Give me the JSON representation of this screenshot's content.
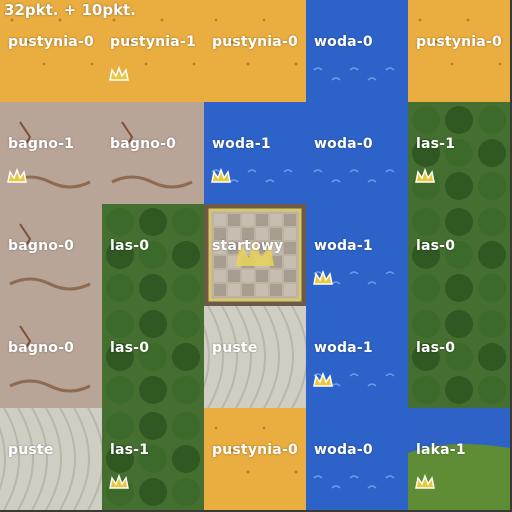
{
  "score": "32pkt. + 10pkt.",
  "tiles": [
    {
      "label": "pustynia-0",
      "terrain": "desert",
      "crowns": 0
    },
    {
      "label": "pustynia-1",
      "terrain": "desert",
      "crowns": 1
    },
    {
      "label": "pustynia-0",
      "terrain": "desert",
      "crowns": 0
    },
    {
      "label": "woda-0",
      "terrain": "water",
      "crowns": 0
    },
    {
      "label": "pustynia-0",
      "terrain": "desert",
      "crowns": 0
    },
    {
      "label": "bagno-1",
      "terrain": "swamp",
      "crowns": 1
    },
    {
      "label": "bagno-0",
      "terrain": "swamp",
      "crowns": 0
    },
    {
      "label": "woda-1",
      "terrain": "water",
      "crowns": 1
    },
    {
      "label": "woda-0",
      "terrain": "water",
      "crowns": 0
    },
    {
      "label": "las-1",
      "terrain": "forest",
      "crowns": 1
    },
    {
      "label": "bagno-0",
      "terrain": "swamp",
      "crowns": 0
    },
    {
      "label": "las-0",
      "terrain": "forest",
      "crowns": 0
    },
    {
      "label": "startowy",
      "terrain": "castle",
      "crowns": 0
    },
    {
      "label": "woda-1",
      "terrain": "water",
      "crowns": 1
    },
    {
      "label": "las-0",
      "terrain": "forest",
      "crowns": 0
    },
    {
      "label": "bagno-0",
      "terrain": "swamp",
      "crowns": 0
    },
    {
      "label": "las-0",
      "terrain": "forest",
      "crowns": 0
    },
    {
      "label": "puste",
      "terrain": "empty",
      "crowns": 0
    },
    {
      "label": "woda-1",
      "terrain": "water",
      "crowns": 1
    },
    {
      "label": "las-0",
      "terrain": "forest",
      "crowns": 0
    },
    {
      "label": "puste",
      "terrain": "empty",
      "crowns": 0
    },
    {
      "label": "las-1",
      "terrain": "forest",
      "crowns": 1
    },
    {
      "label": "pustynia-0",
      "terrain": "desert",
      "crowns": 0
    },
    {
      "label": "woda-0",
      "terrain": "water",
      "crowns": 0
    },
    {
      "label": "laka-1",
      "terrain": "meadow",
      "crowns": 1
    }
  ],
  "colors": {
    "desert": "#e8aa3c",
    "water": "#2a62c8",
    "swamp": "#b9a79a",
    "forest": "#3f6d2c",
    "castle": "#bdb2a2",
    "empty": "#c9c8bc",
    "meadow": "#5d8a34",
    "crown": "#e8c93a"
  }
}
